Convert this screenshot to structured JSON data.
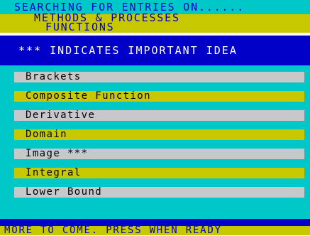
{
  "header": {
    "line1": "SEARCHING FOR ENTRIES ON......",
    "line2": "METHODS & PROCESSES",
    "line3": "FUNCTIONS"
  },
  "note": "*** INDICATES IMPORTANT IDEA",
  "entries": [
    {
      "label": "Brackets"
    },
    {
      "label": "Composite Function"
    },
    {
      "label": "Derivative"
    },
    {
      "label": "Domain"
    },
    {
      "label": "Image ***"
    },
    {
      "label": "Integral"
    },
    {
      "label": "Lower Bound"
    }
  ],
  "footer": "MORE TO COME. PRESS WHEN READY",
  "colors": {
    "cyan": "#00c8c8",
    "yellow": "#c8c800",
    "blue": "#0000c8",
    "grey": "#c8c8c8"
  }
}
